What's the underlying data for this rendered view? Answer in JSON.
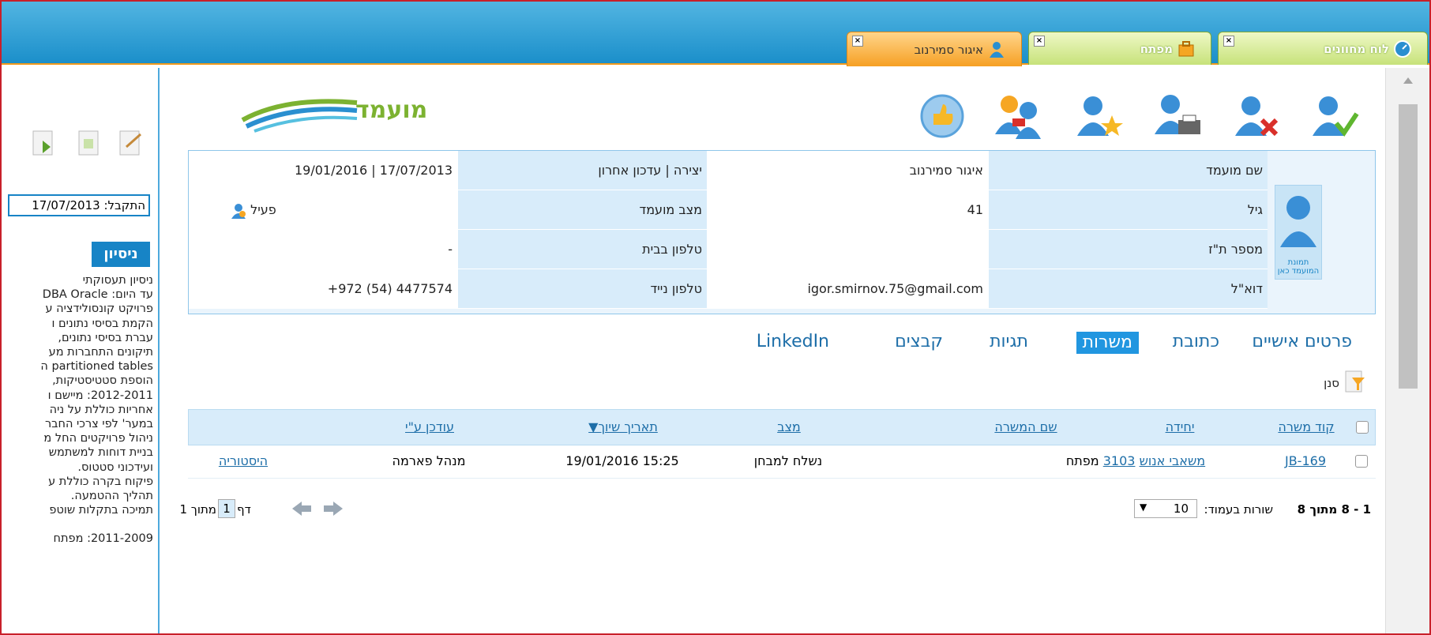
{
  "tabs": [
    {
      "label": "לוח מחוונים",
      "icon": "dashboard-icon"
    },
    {
      "label": "מפתח",
      "icon": "briefcase-icon"
    },
    {
      "label": "איגור סמירנוב",
      "icon": "user-icon"
    }
  ],
  "close_glyph": "×",
  "logo_text": "מועמד",
  "left_panel": {
    "date_label": "התקבל: 17/07/2013",
    "section_title": "ניסיון",
    "lines": [
      "ניסיון תעסוקתי",
      "עד היום: DBA Oracle",
      "פרויקט קונסולידציה ע",
      "הקמת בסיסי נתונים ו",
      "עברת בסיסי נתונים,",
      "תיקונים התחברות מע",
      "partitioned tables ה",
      "הוספת סטטיסטיקות,",
      "2012-2011: מיישם ו",
      "אחריות כוללת על ניה",
      "במער' לפי צרכי החבר",
      "ניהול פרויקטים החל מ",
      "בניית דוחות למשתמש",
      "ועידכוני סטטוס.",
      "פיקוח בקרה כוללת ע",
      "תהליך ההטמעה.",
      "תמיכה בתקלות שוטפ",
      "",
      "2011-2009: מפתח"
    ]
  },
  "info": {
    "photo_caption": "תמונת המועמד כאן",
    "rows": [
      {
        "label1": "שם מועמד",
        "value1": "איגור סמירנוב",
        "label2": "יצירה | עדכון אחרון",
        "value2": "19/01/2016  |  17/07/2013"
      },
      {
        "label1": "גיל",
        "value1": "41",
        "label2": "מצב מועמד",
        "value2": "פעיל"
      },
      {
        "label1": "מספר ת\"ז",
        "value1": "",
        "label2": "טלפון בבית",
        "value2": "-"
      },
      {
        "label1": "דוא\"ל",
        "value1": "igor.smirnov.75@gmail.com",
        "label2": "טלפון נייד",
        "value2": "+972 (54) 4477574"
      }
    ]
  },
  "sub_tabs": [
    "פרטים אישיים",
    "כתובת",
    "משרות",
    "תגיות",
    "קבצים",
    "LinkedIn"
  ],
  "filter_label": "סנן",
  "grid": {
    "headers": {
      "code": "קוד משרה",
      "unit": "יחידה",
      "job_name": "שם המשרה",
      "status": "מצב",
      "date": "תאריך שיוך▼",
      "updated_by": "עודכן ע\"י"
    },
    "rows": [
      {
        "code": "JB-169",
        "unit": "משאבי אנוש",
        "job_num": "3103",
        "job_name": "מפתח",
        "status": "נשלח למבחן",
        "date": "19/01/2016 15:25",
        "updated_by": "מנהל פארמה",
        "history": "היסטוריה"
      }
    ]
  },
  "pager": {
    "range": "1 - 8 מתוך 8",
    "rows_label": "שורות בעמוד:",
    "rows_value": "10",
    "page_label": "דף",
    "page_value": "1",
    "of_label": "מתוך 1"
  }
}
